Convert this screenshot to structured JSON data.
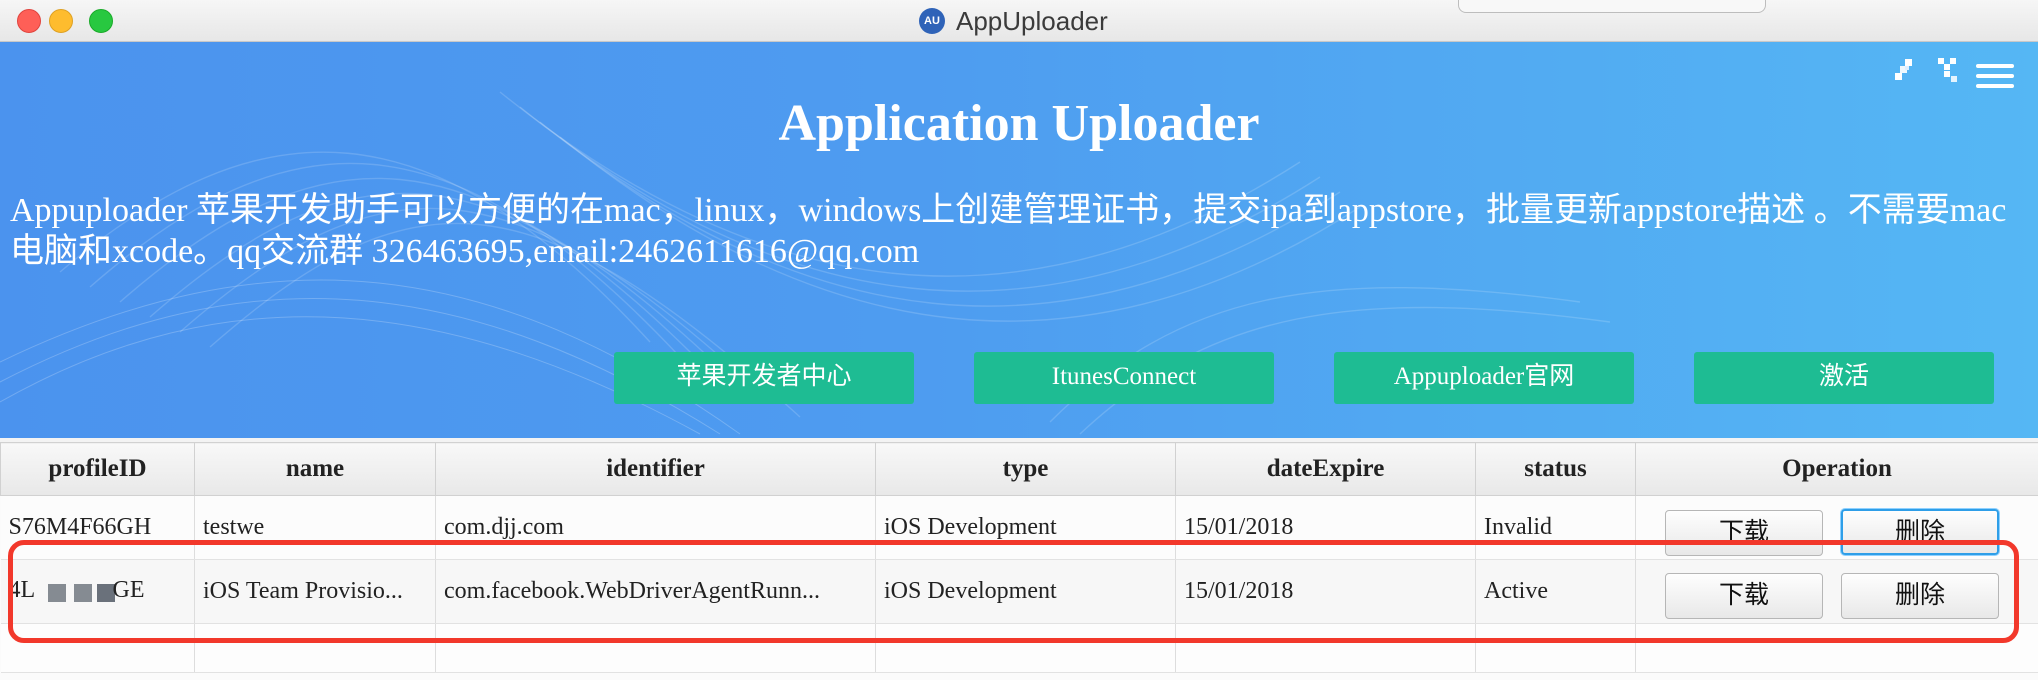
{
  "window": {
    "title": "AppUploader",
    "icon_text": "AU"
  },
  "hero": {
    "title": "Application Uploader",
    "description": "Appuploader 苹果开发助手可以方便的在mac，linux，windows上创建管理证书，提交ipa到appstore，批量更新appstore描述 。不需要mac电脑和xcode。qq交流群 326463695,email:2462611616@qq.com",
    "buttons": [
      {
        "label": "苹果开发者中心"
      },
      {
        "label": "ItunesConnect"
      },
      {
        "label": "Appuploader官网"
      },
      {
        "label": "激活"
      }
    ],
    "colors": {
      "background_start": "#4b93ee",
      "background_end": "#55b7f4",
      "button": "#1ebc93"
    }
  },
  "table": {
    "headers": [
      "profileID",
      "name",
      "identifier",
      "type",
      "dateExpire",
      "status",
      "Operation"
    ],
    "rows": [
      {
        "profileID": "S76M4F66GH",
        "name": "testwe",
        "identifier": "com.djj.com",
        "type": "iOS Development",
        "dateExpire": "15/01/2018",
        "status": "Invalid",
        "download_label": "下载",
        "delete_label": "删除"
      },
      {
        "profileID_prefix": "4L",
        "profileID_suffix": "GE",
        "name": "iOS Team Provisio...",
        "identifier": "com.facebook.WebDriverAgentRunn...",
        "type": "iOS Development",
        "dateExpire": "15/01/2018",
        "status": "Active",
        "download_label": "下载",
        "delete_label": "删除"
      }
    ]
  },
  "annotation": {
    "highlight_color": "#f2382b"
  }
}
